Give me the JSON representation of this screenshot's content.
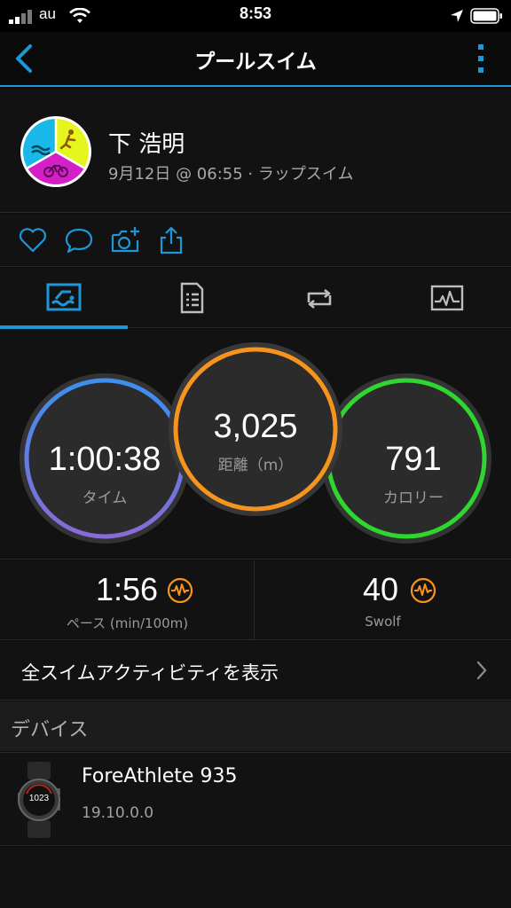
{
  "status_bar": {
    "carrier": "au",
    "time": "8:53"
  },
  "nav": {
    "title": "プールスイム",
    "back_icon": "chevron-left-icon",
    "menu_icon": "more-vertical-icon"
  },
  "activity": {
    "user_name": "下 浩明",
    "subtitle": "9月12日 @ 06:55 · ラップスイム"
  },
  "actions": [
    {
      "icon": "heart-icon"
    },
    {
      "icon": "comment-icon"
    },
    {
      "icon": "add-photo-icon"
    },
    {
      "icon": "share-icon"
    }
  ],
  "tabs": [
    {
      "icon": "swim-summary-icon",
      "active": true
    },
    {
      "icon": "details-list-icon",
      "active": false
    },
    {
      "icon": "laps-icon",
      "active": false
    },
    {
      "icon": "chart-icon",
      "active": false
    }
  ],
  "metrics": {
    "time": {
      "value": "1:00:38",
      "label": "タイム"
    },
    "distance": {
      "value": "3,025",
      "label": "距離（m）"
    },
    "calories": {
      "value": "791",
      "label": "カロリー"
    }
  },
  "stats": {
    "pace": {
      "value": "1:56",
      "label": "ペース (min/100m)"
    },
    "swolf": {
      "value": "40",
      "label": "Swolf"
    }
  },
  "all_swims_label": "全スイムアクティビティを表示",
  "devices_section_label": "デバイス",
  "device": {
    "name": "ForeAthlete 935",
    "version": "19.10.0.0",
    "watch_face_time": "1023"
  },
  "colors": {
    "accent": "#1d97d8",
    "time_ring": "#6a7fe0",
    "distance_ring": "#f7941d",
    "calories_ring": "#2fd62f",
    "stat_icon": "#f7941d"
  }
}
